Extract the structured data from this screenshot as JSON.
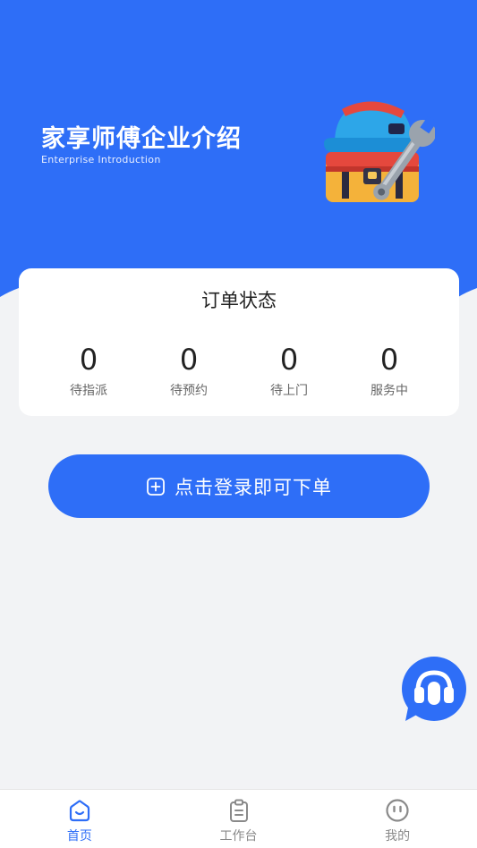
{
  "hero": {
    "title": "家享师傅企业介绍",
    "subtitle": "Enterprise Introduction",
    "background_color": "#2e6ef7",
    "illustration_icon": "helmet-toolbox-wrench-icon"
  },
  "order_status": {
    "title": "订单状态",
    "items": [
      {
        "count": "0",
        "label": "待指派"
      },
      {
        "count": "0",
        "label": "待预约"
      },
      {
        "count": "0",
        "label": "待上门"
      },
      {
        "count": "0",
        "label": "服务中"
      }
    ]
  },
  "login_button": {
    "label": "点击登录即可下单",
    "icon": "plus-square-icon",
    "color": "#2e6ef7"
  },
  "service_fab": {
    "icon": "headset-icon"
  },
  "tabbar": {
    "active_color": "#2e6ef7",
    "items": [
      {
        "label": "首页",
        "icon": "home-icon",
        "active": true
      },
      {
        "label": "工作台",
        "icon": "clipboard-icon",
        "active": false
      },
      {
        "label": "我的",
        "icon": "profile-face-icon",
        "active": false
      }
    ]
  }
}
